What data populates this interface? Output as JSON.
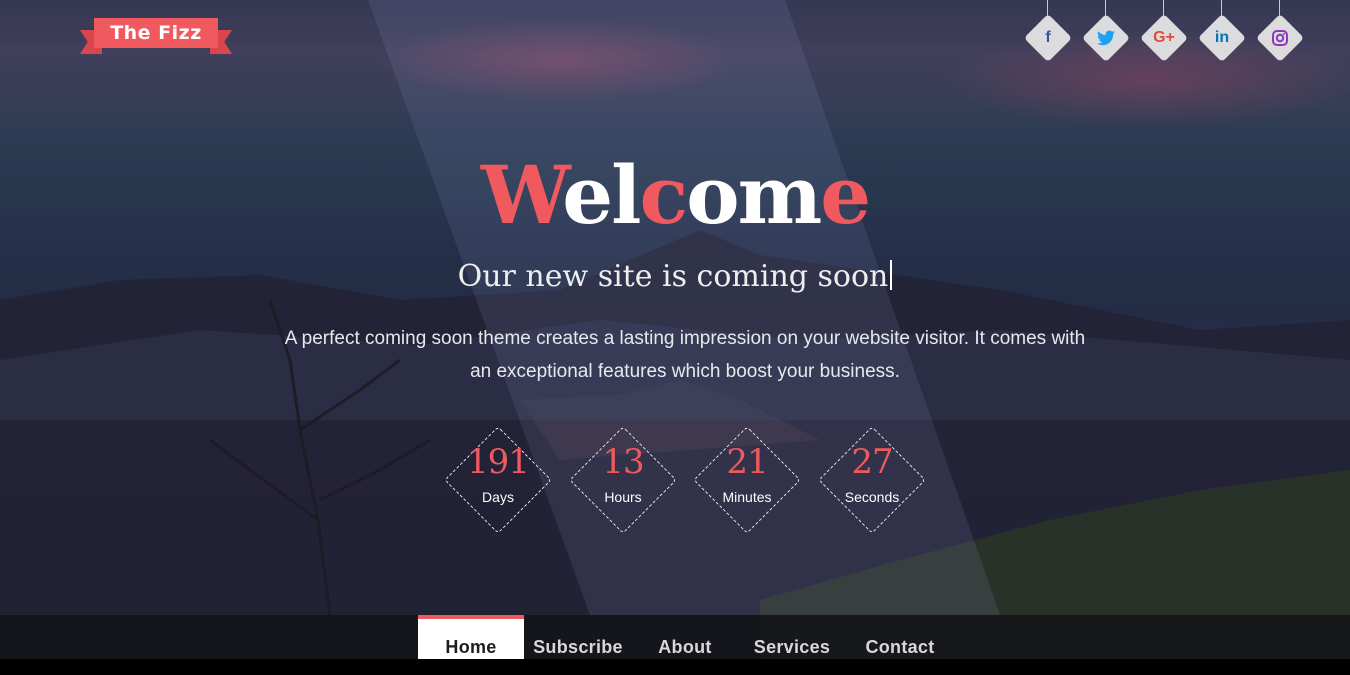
{
  "brand": {
    "logo_text": "The Fizz",
    "accent_color": "#f0595e"
  },
  "social": [
    {
      "name": "facebook",
      "glyph": "f",
      "color": "#3b5998"
    },
    {
      "name": "twitter",
      "glyph": "t",
      "color": "#1da1f2"
    },
    {
      "name": "google-plus",
      "glyph": "G+",
      "color": "#dd4b39"
    },
    {
      "name": "linkedin",
      "glyph": "in",
      "color": "#0077b5"
    },
    {
      "name": "instagram",
      "glyph": "◎",
      "color": "#8a3ab9"
    }
  ],
  "hero": {
    "title_parts": [
      {
        "text": "W",
        "color": "red"
      },
      {
        "text": "el",
        "color": "white"
      },
      {
        "text": "c",
        "color": "red"
      },
      {
        "text": "om",
        "color": "white"
      },
      {
        "text": "e",
        "color": "red"
      }
    ],
    "subtitle": "Our new site is coming soon",
    "description": "A perfect coming soon theme creates a lasting impression on your website visitor. It comes with an exceptional features which boost your business."
  },
  "countdown": [
    {
      "value": "191",
      "label": "Days"
    },
    {
      "value": "13",
      "label": "Hours"
    },
    {
      "value": "21",
      "label": "Minutes"
    },
    {
      "value": "27",
      "label": "Seconds"
    }
  ],
  "nav": {
    "items": [
      "Home",
      "Subscribe",
      "About",
      "Services",
      "Contact"
    ],
    "active": "Home"
  }
}
